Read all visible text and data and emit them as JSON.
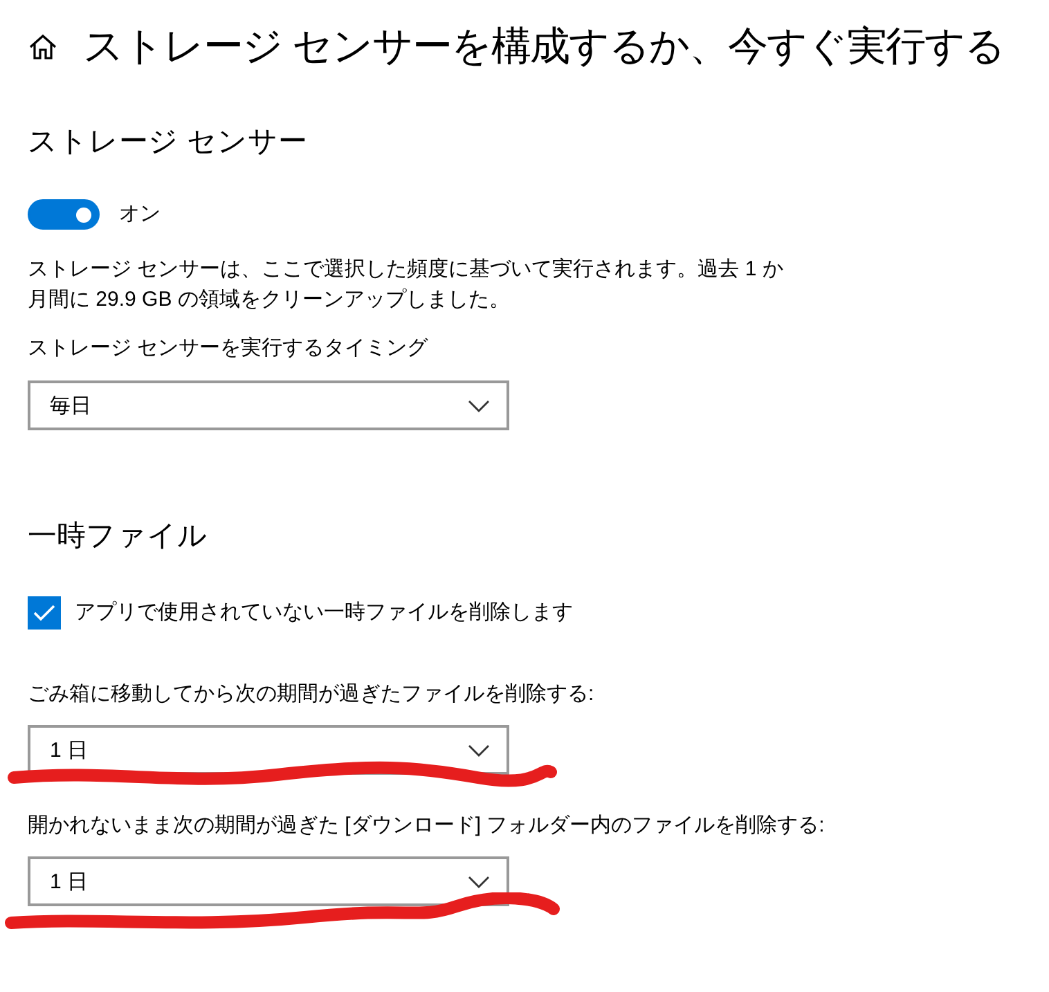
{
  "header": {
    "title": "ストレージ センサーを構成するか、今すぐ実行する"
  },
  "storage_sense": {
    "heading": "ストレージ センサー",
    "toggle": {
      "on": true,
      "label": "オン"
    },
    "description": "ストレージ センサーは、ここで選択した頻度に基づいて実行されます。過去 1 か月間に 29.9 GB の領域をクリーンアップしました。",
    "run_label": "ストレージ センサーを実行するタイミング",
    "run_value": "毎日"
  },
  "temp_files": {
    "heading": "一時ファイル",
    "checkbox": {
      "label": "アプリで使用されていない一時ファイルを削除します",
      "checked": true
    },
    "dropdowns": [
      {
        "label": "ごみ箱に移動してから次の期間が過ぎたファイルを削除する:",
        "value": "1 日",
        "underlined": true
      },
      {
        "label": "開かれないまま次の期間が過ぎた [ダウンロード] フォルダー内のファイルを削除する:",
        "value": "1 日",
        "underlined": true
      }
    ]
  }
}
